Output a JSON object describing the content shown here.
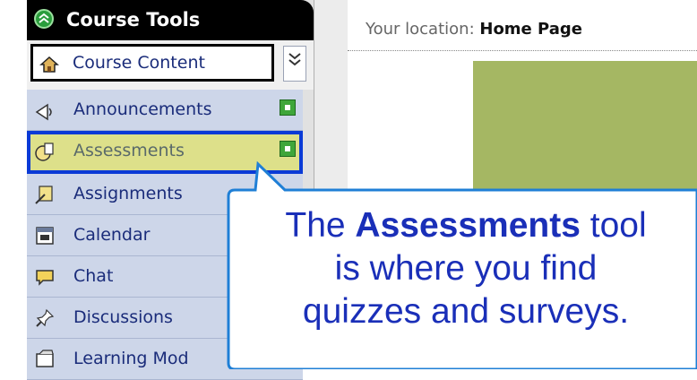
{
  "sidebar": {
    "header": {
      "title": "Course Tools"
    },
    "items": [
      {
        "label": "Course Content",
        "icon": "home-icon"
      },
      {
        "label": "Announcements",
        "icon": "megaphone-icon"
      },
      {
        "label": "Assessments",
        "icon": "assessment-icon"
      },
      {
        "label": "Assignments",
        "icon": "assignment-icon"
      },
      {
        "label": "Calendar",
        "icon": "calendar-icon"
      },
      {
        "label": "Chat",
        "icon": "chat-icon"
      },
      {
        "label": "Discussions",
        "icon": "pin-icon"
      },
      {
        "label": "Learning Mod",
        "icon": "module-icon"
      }
    ]
  },
  "breadcrumb": {
    "prefix": "Your location:",
    "current": "Home Page"
  },
  "callout": {
    "line1_pre": "The ",
    "line1_bold": "Assessments",
    "line1_post": " tool",
    "line2": "is where you find",
    "line3": "quizzes and surveys."
  },
  "colors": {
    "accent_blue": "#0a3ad6",
    "selected_bg": "#dde08a",
    "nav_bg": "#cdd6e9",
    "banner": "#a5b763"
  }
}
